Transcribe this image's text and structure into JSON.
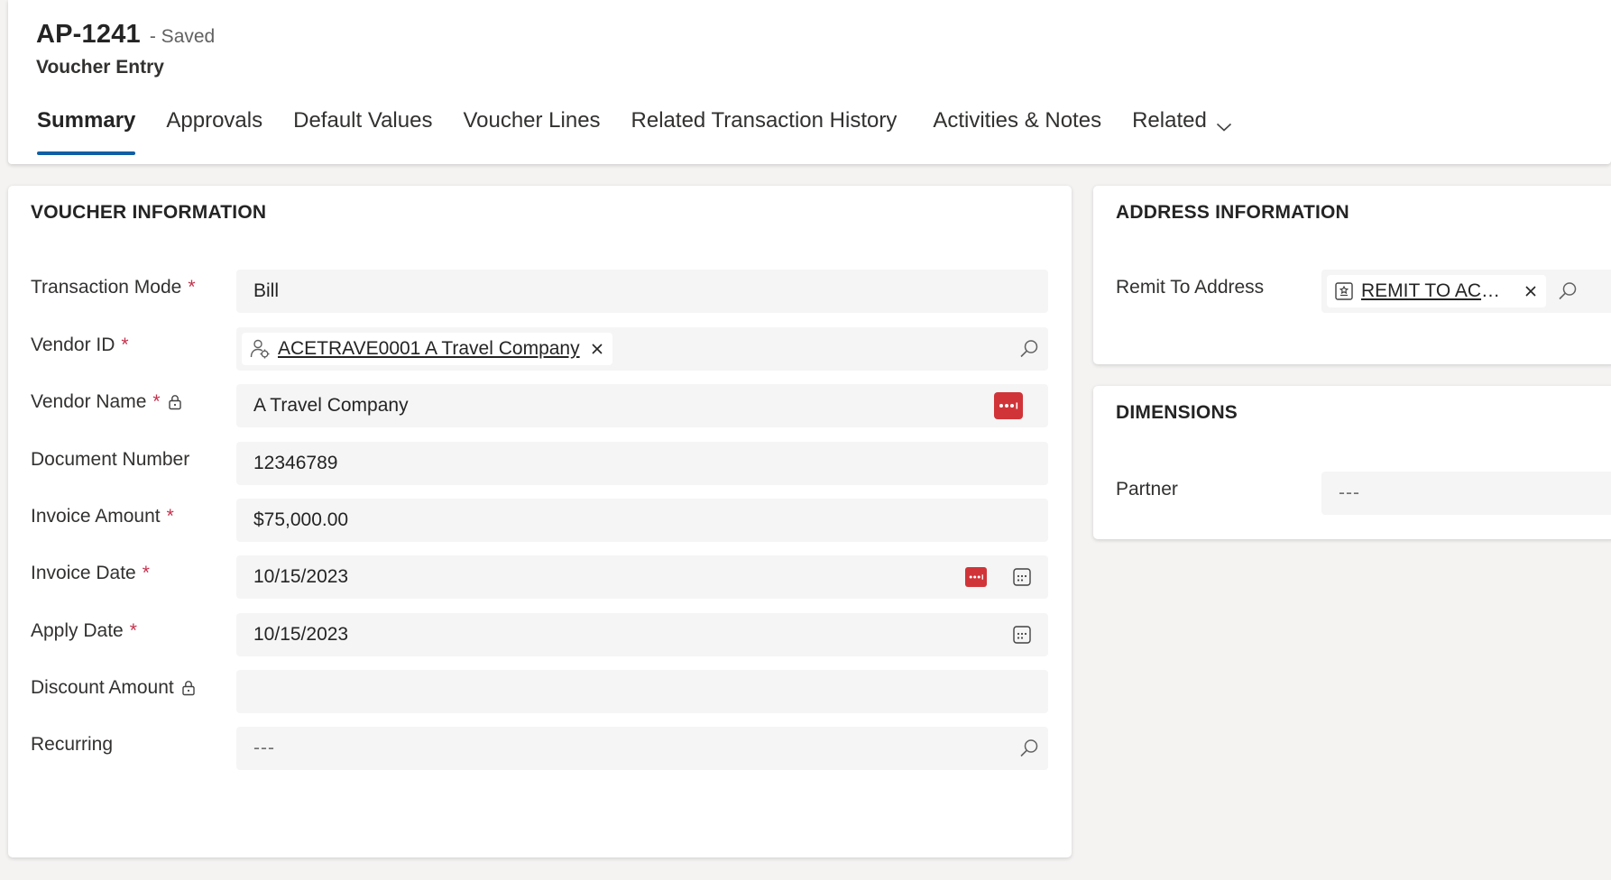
{
  "header": {
    "record_id": "AP-1241",
    "save_status": "- Saved",
    "entity_name": "Voucher Entry"
  },
  "tabs": [
    {
      "label": "Summary",
      "active": true
    },
    {
      "label": "Approvals"
    },
    {
      "label": "Default Values"
    },
    {
      "label": "Voucher Lines"
    },
    {
      "label": "Related Transaction History"
    },
    {
      "label": "Activities & Notes"
    },
    {
      "label": "Related"
    }
  ],
  "voucher_section": {
    "title": "VOUCHER INFORMATION",
    "required_marker": "*",
    "fields": {
      "transaction_mode": {
        "label": "Transaction Mode",
        "value": "Bill"
      },
      "vendor_id": {
        "label": "Vendor ID",
        "value": "ACETRAVE0001 A Travel Company"
      },
      "vendor_name": {
        "label": "Vendor Name",
        "value": "A Travel Company"
      },
      "document_number": {
        "label": "Document Number",
        "value": "12346789"
      },
      "invoice_amount": {
        "label": "Invoice Amount",
        "value": "$75,000.00"
      },
      "invoice_date": {
        "label": "Invoice Date",
        "value": "10/15/2023"
      },
      "apply_date": {
        "label": "Apply Date",
        "value": "10/15/2023"
      },
      "discount_amount": {
        "label": "Discount Amount",
        "value": ""
      },
      "recurring": {
        "label": "Recurring",
        "value": "---"
      }
    }
  },
  "address_section": {
    "title": "ADDRESS INFORMATION",
    "remit_to": {
      "label": "Remit To Address",
      "value": "REMIT TO ACET..."
    }
  },
  "dimensions_section": {
    "title": "DIMENSIONS",
    "partner": {
      "label": "Partner",
      "value": "---"
    }
  },
  "colors": {
    "accent": "#115ea3",
    "required": "#c4314b",
    "badge": "#d13438"
  }
}
